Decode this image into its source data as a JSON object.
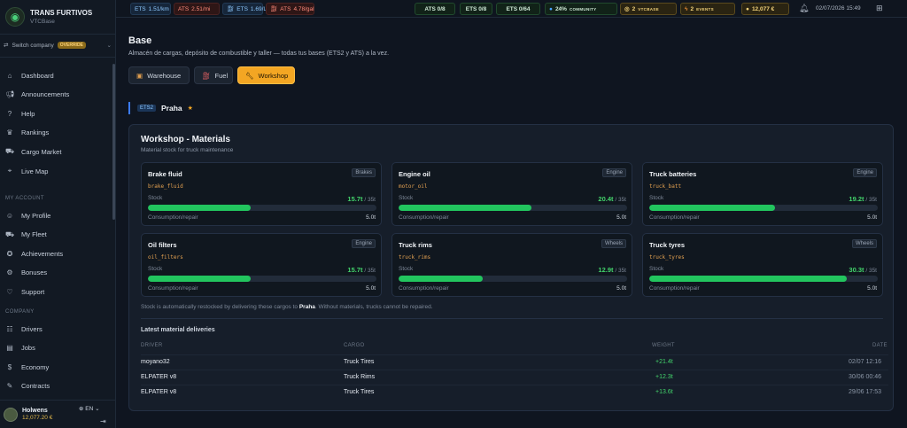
{
  "sidebar": {
    "brand_name": "TRANS FURTIVOS",
    "brand_sub": "VTCBase",
    "switch_label": "Switch company",
    "override_badge": "OVERRIDE",
    "main_items": [
      {
        "label": "Dashboard",
        "icon": "home-icon"
      },
      {
        "label": "Announcements",
        "icon": "megaphone-icon"
      },
      {
        "label": "Help",
        "icon": "help-icon"
      },
      {
        "label": "Rankings",
        "icon": "trophy-icon"
      },
      {
        "label": "Cargo Market",
        "icon": "cart-icon"
      },
      {
        "label": "Live Map",
        "icon": "map-icon"
      }
    ],
    "account_section": "MY ACCOUNT",
    "account_items": [
      {
        "label": "My Profile",
        "icon": "user-icon"
      },
      {
        "label": "My Fleet",
        "icon": "truck-icon"
      },
      {
        "label": "Achievements",
        "icon": "medal-icon"
      },
      {
        "label": "Bonuses",
        "icon": "gift-icon"
      },
      {
        "label": "Support",
        "icon": "heart-icon"
      }
    ],
    "company_section": "COMPANY",
    "company_items": [
      {
        "label": "Drivers",
        "icon": "drivers-icon"
      },
      {
        "label": "Jobs",
        "icon": "jobs-icon"
      },
      {
        "label": "Economy",
        "icon": "economy-icon"
      },
      {
        "label": "Contracts",
        "icon": "contracts-icon"
      }
    ],
    "user_name": "Holwens",
    "user_money": "12,077.20 €",
    "language": "EN"
  },
  "topbar": {
    "fuel": [
      {
        "game": "ETS",
        "value": "1.51/km",
        "style": "ets"
      },
      {
        "game": "ATS",
        "value": "2.51/mi",
        "style": "ats"
      },
      {
        "game": "ETS",
        "value": "1.69/L",
        "style": "ets"
      },
      {
        "game": "ATS",
        "value": "4.78/gal",
        "style": "ats"
      }
    ],
    "counts": [
      {
        "label": "ATS 0/8"
      },
      {
        "label": "ETS 0/8"
      },
      {
        "label": "ETS 0/64"
      }
    ],
    "community_value": "24%",
    "community_label": "COMMUNITY",
    "vtcbase_value": "2",
    "vtcbase_label": "VTCBASE",
    "events_value": "2",
    "events_label": "EVENTS",
    "balance": "12,077 €",
    "date": "02/07/2026 15:49"
  },
  "page": {
    "title": "Base",
    "subtitle": "Almacén de cargas, depósito de combustible y taller — todas tus bases (ETS2 y ATS) a la vez.",
    "tabs": [
      {
        "label": "Warehouse",
        "icon": "box-icon",
        "active": false
      },
      {
        "label": "Fuel",
        "icon": "fuel-icon",
        "active": false
      },
      {
        "label": "Workshop",
        "icon": "wrench-icon",
        "active": true
      }
    ],
    "base_game": "ETS2",
    "base_name": "Praha"
  },
  "workshop": {
    "title": "Workshop - Materials",
    "subtitle": "Material stock for truck maintenance",
    "stock_label": "Stock",
    "consumption_label": "Consumption/repair",
    "materials": [
      {
        "name": "Brake fluid",
        "category": "Brakes",
        "code": "brake_fluid",
        "stock": "15.7t",
        "capacity": "/ 35t",
        "level": 0.449,
        "consumption": "5.0t"
      },
      {
        "name": "Engine oil",
        "category": "Engine",
        "code": "motor_oil",
        "stock": "20.4t",
        "capacity": "/ 35t",
        "level": 0.583,
        "consumption": "5.0t"
      },
      {
        "name": "Truck batteries",
        "category": "Engine",
        "code": "truck_batt",
        "stock": "19.2t",
        "capacity": "/ 35t",
        "level": 0.549,
        "consumption": "5.0t"
      },
      {
        "name": "Oil filters",
        "category": "Engine",
        "code": "oil_filters",
        "stock": "15.7t",
        "capacity": "/ 35t",
        "level": 0.449,
        "consumption": "5.0t"
      },
      {
        "name": "Truck rims",
        "category": "Wheels",
        "code": "truck_rims",
        "stock": "12.9t",
        "capacity": "/ 35t",
        "level": 0.369,
        "consumption": "5.0t"
      },
      {
        "name": "Truck tyres",
        "category": "Wheels",
        "code": "truck_tyres",
        "stock": "30.3t",
        "capacity": "/ 35t",
        "level": 0.866,
        "consumption": "5.0t"
      }
    ],
    "note_prefix": "Stock is automatically restocked by delivering these cargos to",
    "note_city": "Praha",
    "note_suffix": ". Without materials, trucks cannot be repaired."
  },
  "deliveries": {
    "title": "Latest material deliveries",
    "columns": {
      "driver": "DRIVER",
      "cargo": "CARGO",
      "weight": "WEIGHT",
      "date": "DATE"
    },
    "rows": [
      {
        "driver": "moyano32",
        "cargo": "Truck Tires",
        "weight": "+21.4t",
        "date": "02/07 12:16"
      },
      {
        "driver": "ELPATER v8",
        "cargo": "Truck Rims",
        "weight": "+12.3t",
        "date": "30/06 00:46"
      },
      {
        "driver": "ELPATER v8",
        "cargo": "Truck Tires",
        "weight": "+13.6t",
        "date": "29/06 17:53"
      }
    ]
  }
}
